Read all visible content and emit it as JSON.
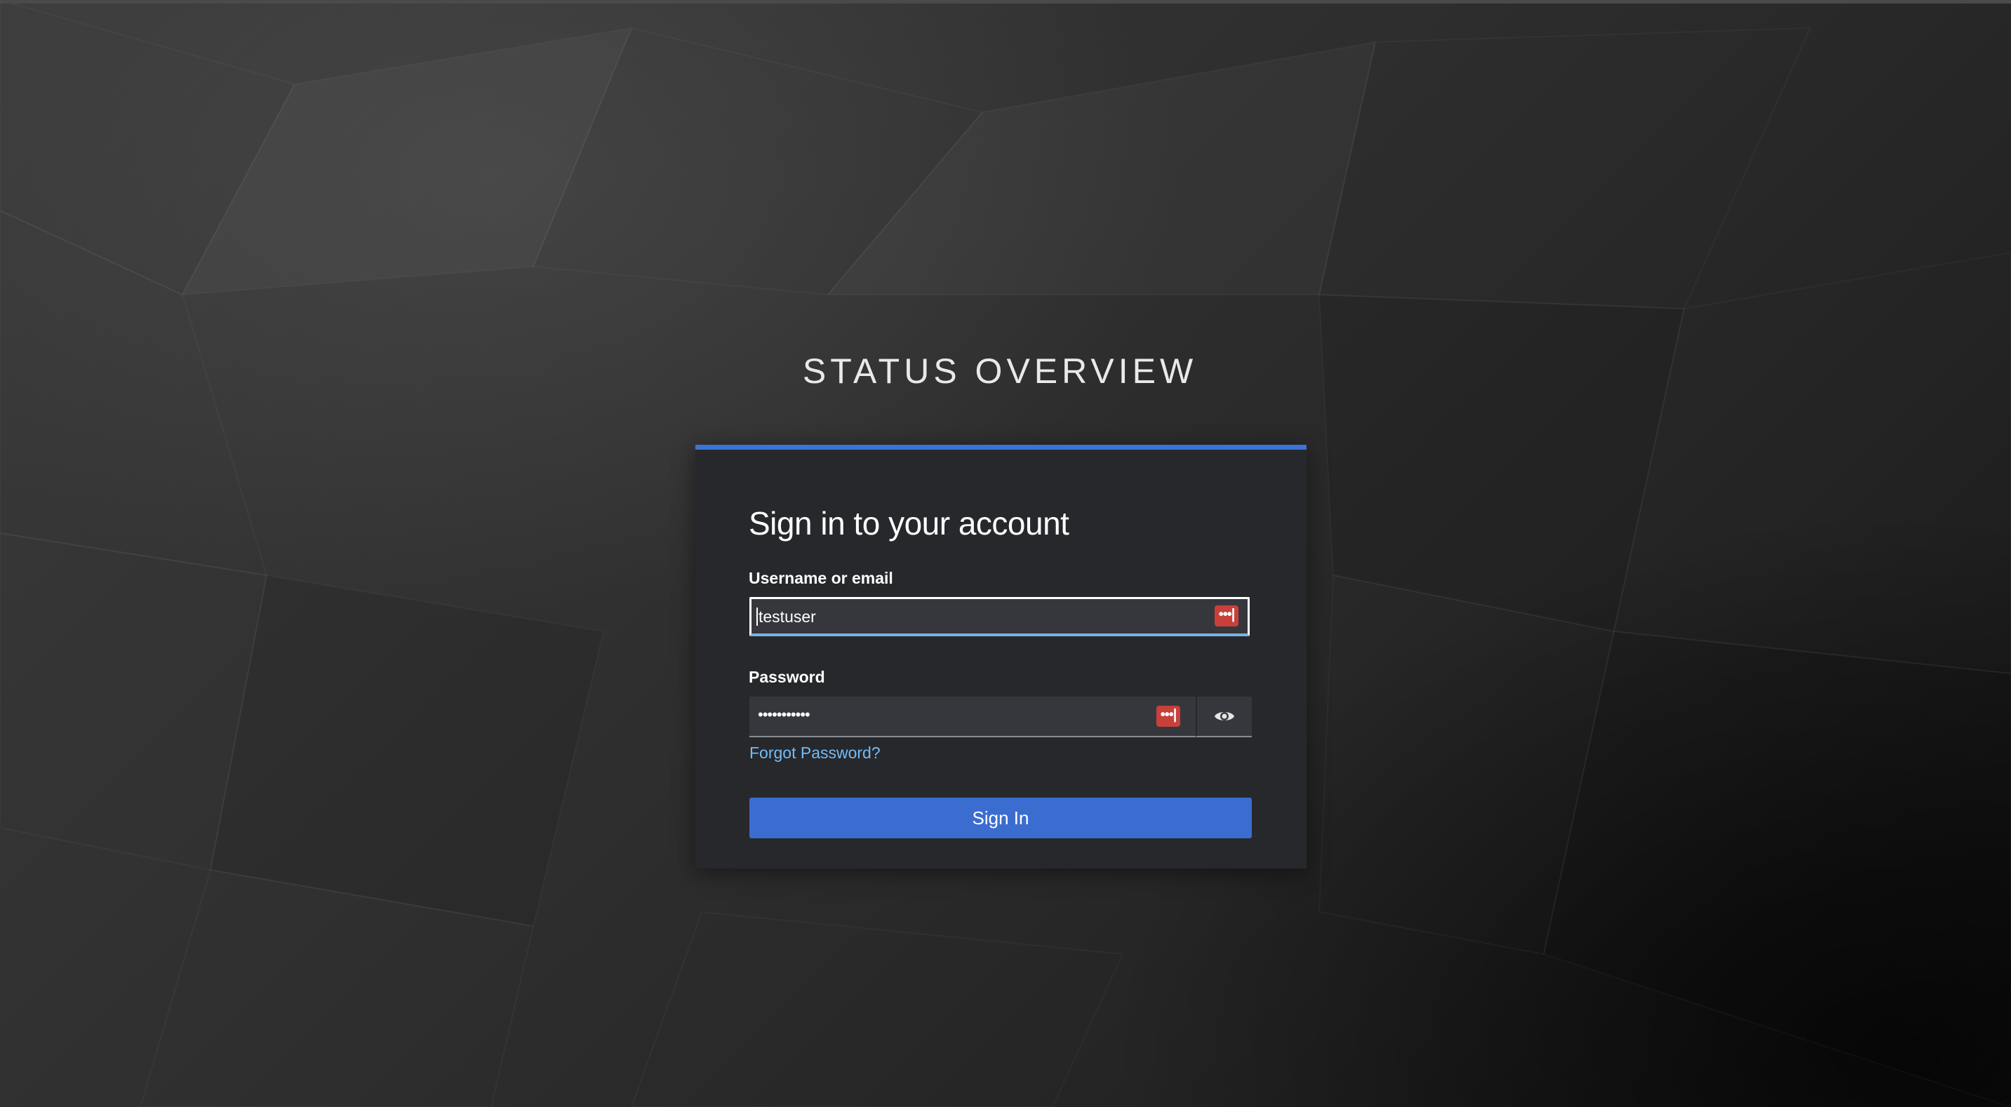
{
  "header": {
    "brand_title": "STATUS OVERVIEW"
  },
  "login": {
    "title": "Sign in to your account",
    "username_label": "Username or email",
    "username_value": "testuser",
    "password_label": "Password",
    "password_value": "•••••••••••",
    "password_manager_badge": "•••|",
    "forgot_password_link": "Forgot Password?",
    "signin_button": "Sign In",
    "show_password_icon": "eye-icon"
  },
  "colors": {
    "accent": "#3b73d6",
    "button": "#3b6dd1",
    "link": "#73bcf7",
    "card_background": "#27282c",
    "input_background": "#36373c",
    "password_badge": "#c9403a"
  }
}
